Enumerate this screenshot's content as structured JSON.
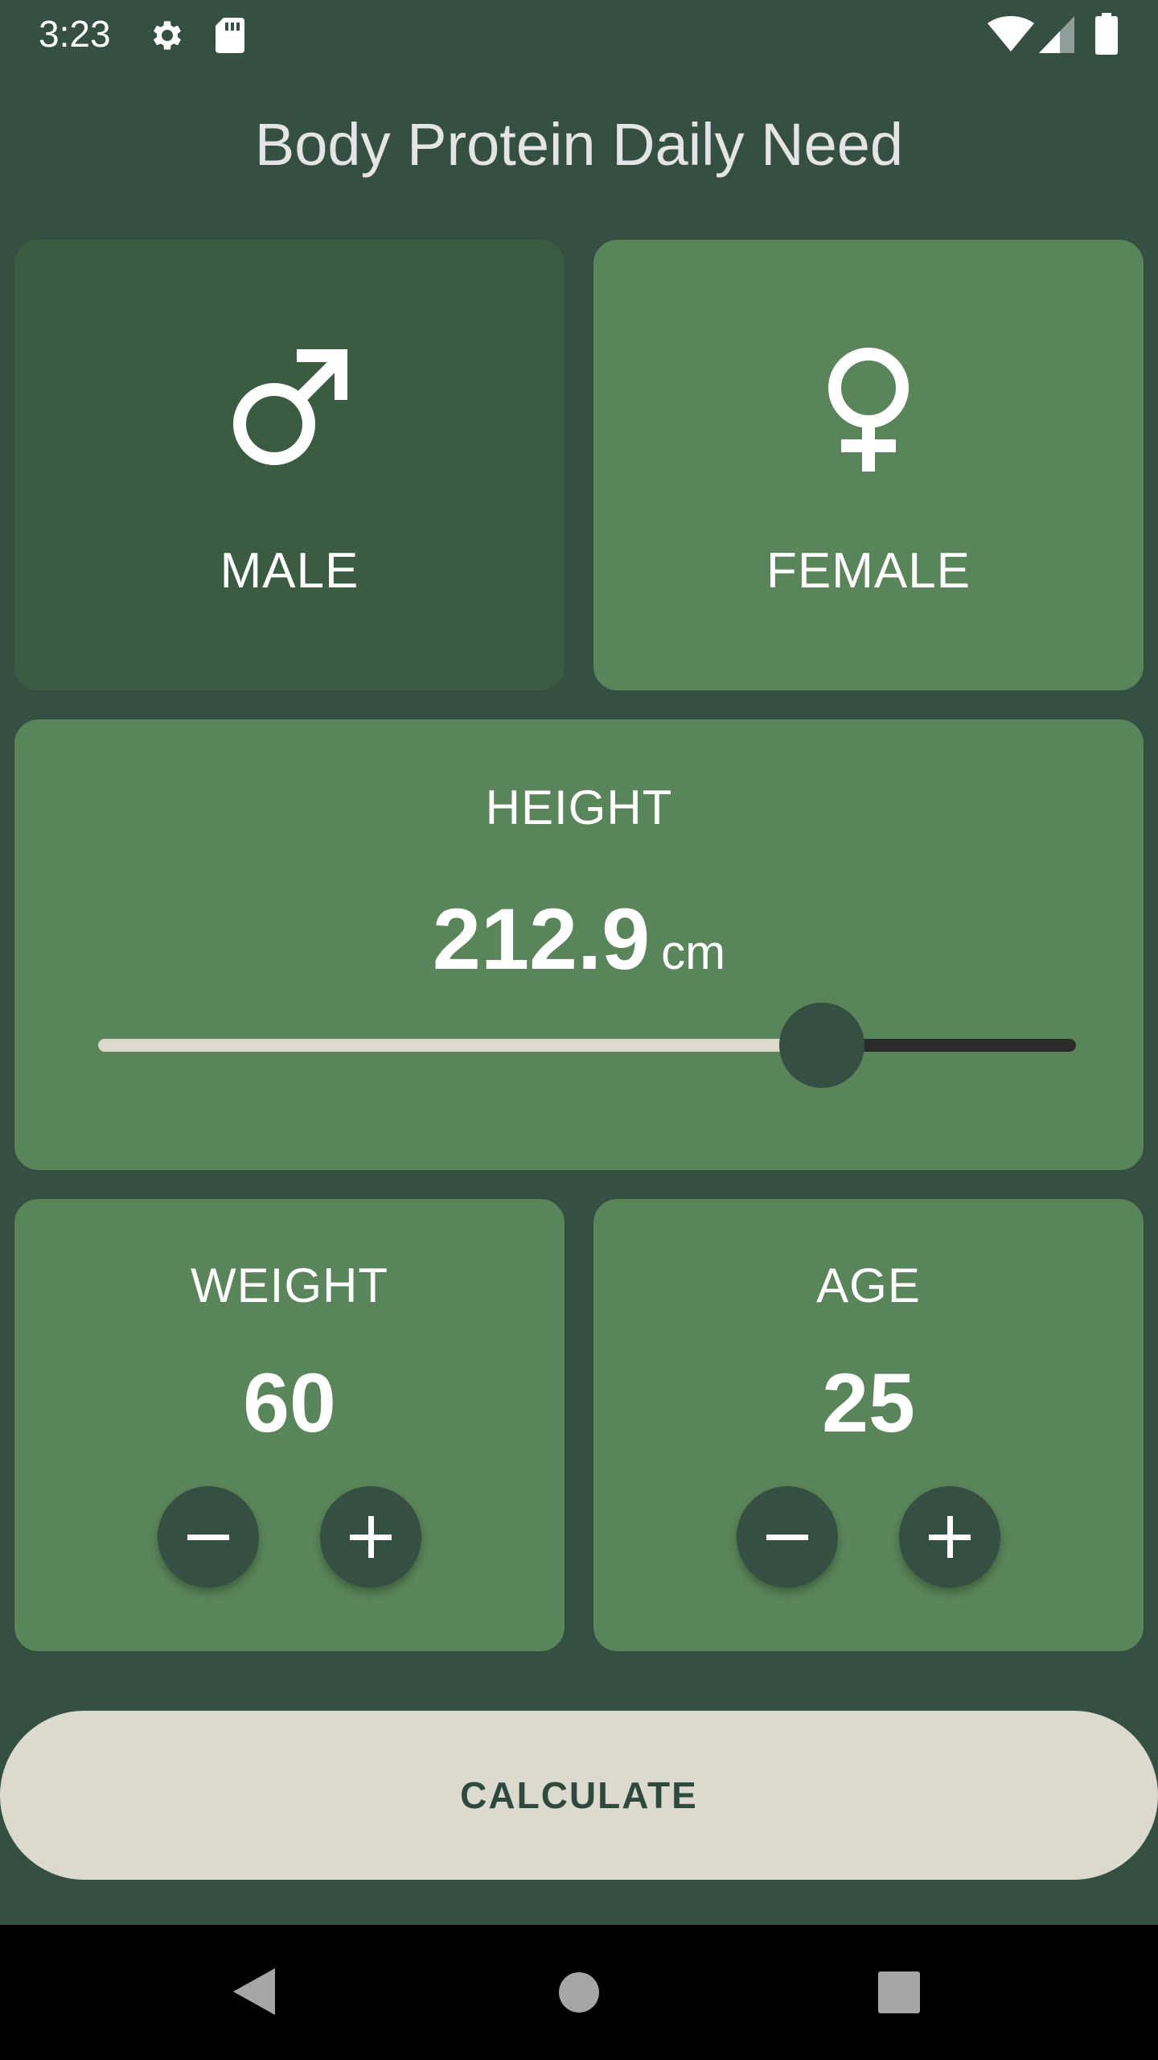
{
  "status_bar": {
    "time": "3:23",
    "icons": [
      "gear-icon",
      "sd-card-icon",
      "wifi-icon",
      "signal-icon",
      "battery-icon"
    ]
  },
  "title": "Body Protein Daily Need",
  "gender": {
    "male": {
      "label": "MALE",
      "icon": "male-symbol-icon",
      "selected": true
    },
    "female": {
      "label": "FEMALE",
      "icon": "female-symbol-icon",
      "selected": false
    }
  },
  "height": {
    "label": "HEIGHT",
    "value": "212.9",
    "unit": "cm",
    "slider_fraction": 0.74
  },
  "weight": {
    "label": "WEIGHT",
    "value": "60"
  },
  "age": {
    "label": "AGE",
    "value": "25"
  },
  "calculate_label": "CALCULATE",
  "colors": {
    "background": "#354f42",
    "card": "#5a8459",
    "card_selected": "#3b5c41",
    "button_light": "#dcd9ce",
    "slider_active": "#dcd9ce",
    "slider_inactive": "#2b2b2b"
  },
  "nav_bar": {
    "icons": [
      "back-icon",
      "home-icon",
      "recents-icon"
    ]
  }
}
